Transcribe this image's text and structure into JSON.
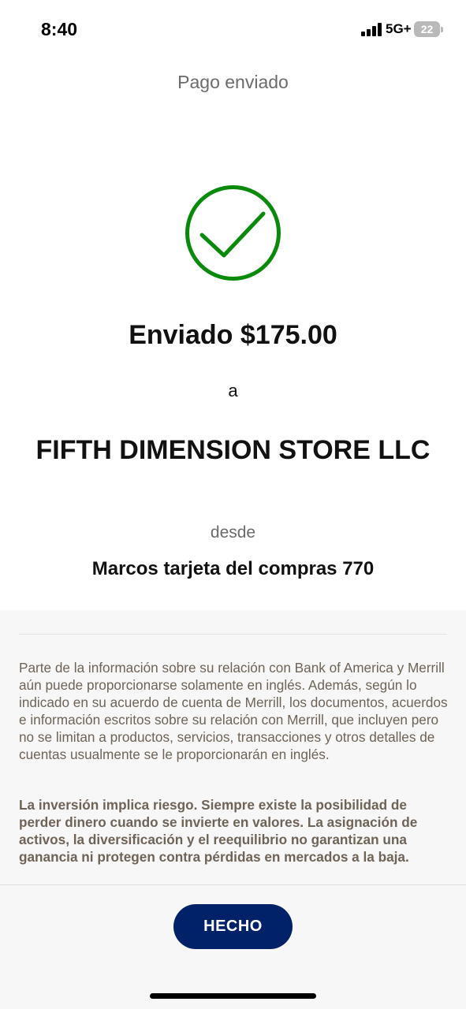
{
  "status_bar": {
    "time": "8:40",
    "network": "5G+",
    "battery": "22"
  },
  "header": {
    "title": "Pago enviado"
  },
  "confirmation": {
    "icon": "check-circle-icon",
    "accent_color": "#0a8a0a",
    "amount_text": "Enviado $175.00",
    "to_text": "a",
    "recipient": "FIFTH DIMENSION STORE LLC",
    "from_text": "desde",
    "source_account": "Marcos tarjeta del compras 770"
  },
  "disclosure": {
    "language_notice": "Parte de la información sobre su relación con Bank of America y Merrill aún puede proporcionarse solamente en inglés. Además, según lo indicado en su acuerdo de cuenta de Merrill, los documentos, acuerdos e información escritos sobre su relación con Merrill, que incluyen pero no se limitan a productos, servicios, transacciones y otros detalles de cuentas usualmente se le proporcionarán en inglés.",
    "risk_notice": "La inversión implica riesgo. Siempre existe la posibilidad de perder dinero cuando se invierte en valores. La asignación de activos, la diversificación y el reequilibrio no garantizan una ganancia ni protegen contra pérdidas en mercados a la baja."
  },
  "footer": {
    "done_label": "HECHO",
    "button_color": "#012169"
  }
}
